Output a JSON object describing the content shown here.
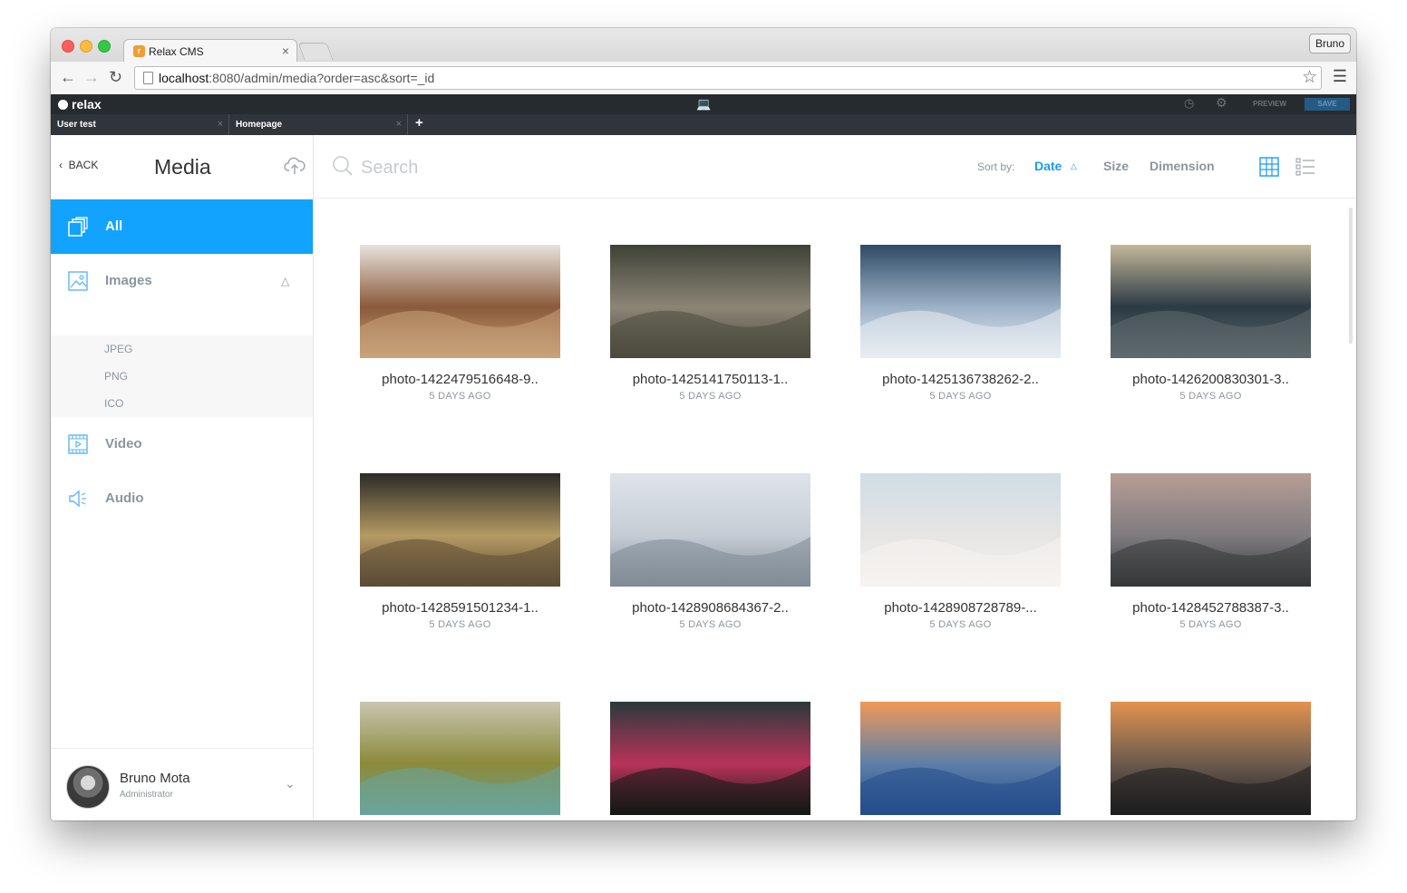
{
  "browser": {
    "tab_title": "Relax CMS",
    "tab_favicon_letter": "r",
    "tab_close": "×",
    "profile": "Bruno",
    "url_host": "localhost",
    "url_path": ":8080/admin/media?order=asc&sort=_id"
  },
  "appbar": {
    "logo": "relax",
    "preview": "PREVIEW",
    "save": "SAVE",
    "tabs": [
      {
        "label": "User test",
        "close": "×"
      },
      {
        "label": "Homepage",
        "close": "×"
      }
    ],
    "add_tab": "+"
  },
  "sidebar": {
    "back": "BACK",
    "title": "Media",
    "items": [
      {
        "label": "All",
        "icon": "copy-icon",
        "active": true
      },
      {
        "label": "Images",
        "icon": "image-icon"
      },
      {
        "label": "Video",
        "icon": "film-icon"
      },
      {
        "label": "Audio",
        "icon": "speaker-icon"
      }
    ],
    "image_subitems": [
      "JPEG",
      "PNG",
      "ICO"
    ],
    "user": {
      "name": "Bruno Mota",
      "role": "Administrator"
    }
  },
  "main": {
    "search_placeholder": "Search",
    "sort_label": "Sort by:",
    "sort_options": [
      "Date",
      "Size",
      "Dimension"
    ],
    "sort_active": "Date",
    "sort_direction": "asc",
    "view_mode": "grid",
    "media": [
      {
        "name": "photo-1422479516648-9..",
        "date": "5 DAYS AGO",
        "palette": [
          "#e8e3dc",
          "#8a5a3a",
          "#c9a27a"
        ]
      },
      {
        "name": "photo-1425141750113-1..",
        "date": "5 DAYS AGO",
        "palette": [
          "#3e4236",
          "#8b8576",
          "#4b4a3c"
        ]
      },
      {
        "name": "photo-1425136738262-2..",
        "date": "5 DAYS AGO",
        "palette": [
          "#2f4a66",
          "#9cb1c6",
          "#e7edf3"
        ]
      },
      {
        "name": "photo-1426200830301-3..",
        "date": "5 DAYS AGO",
        "palette": [
          "#c4b79a",
          "#2b3a44",
          "#5f6a6e"
        ]
      },
      {
        "name": "photo-1428591501234-1..",
        "date": "5 DAYS AGO",
        "palette": [
          "#2b2a26",
          "#b59a62",
          "#5c4c36"
        ]
      },
      {
        "name": "photo-1428908684367-2..",
        "date": "5 DAYS AGO",
        "palette": [
          "#dfe4ea",
          "#c5ccd5",
          "#7f8b96"
        ]
      },
      {
        "name": "photo-1428908728789-...",
        "date": "5 DAYS AGO",
        "palette": [
          "#cfdde6",
          "#e7e5e3",
          "#f5f3f1"
        ]
      },
      {
        "name": "photo-1428452788387-3..",
        "date": "5 DAYS AGO",
        "palette": [
          "#b89e95",
          "#7f7c80",
          "#363839"
        ]
      },
      {
        "name": "",
        "date": "",
        "palette": [
          "#c9c6b1",
          "#8b8a3a",
          "#6aa49a"
        ]
      },
      {
        "name": "",
        "date": "",
        "palette": [
          "#2a3a3a",
          "#b8335a",
          "#121815"
        ]
      },
      {
        "name": "",
        "date": "",
        "palette": [
          "#ef9a56",
          "#5d7fa8",
          "#244d8c"
        ]
      },
      {
        "name": "",
        "date": "",
        "palette": [
          "#e3934f",
          "#6a5a4e",
          "#1e1e1f"
        ]
      }
    ]
  },
  "colors": {
    "accent": "#11a3ff",
    "appbar": "#262b30",
    "muted": "#8c959d"
  }
}
